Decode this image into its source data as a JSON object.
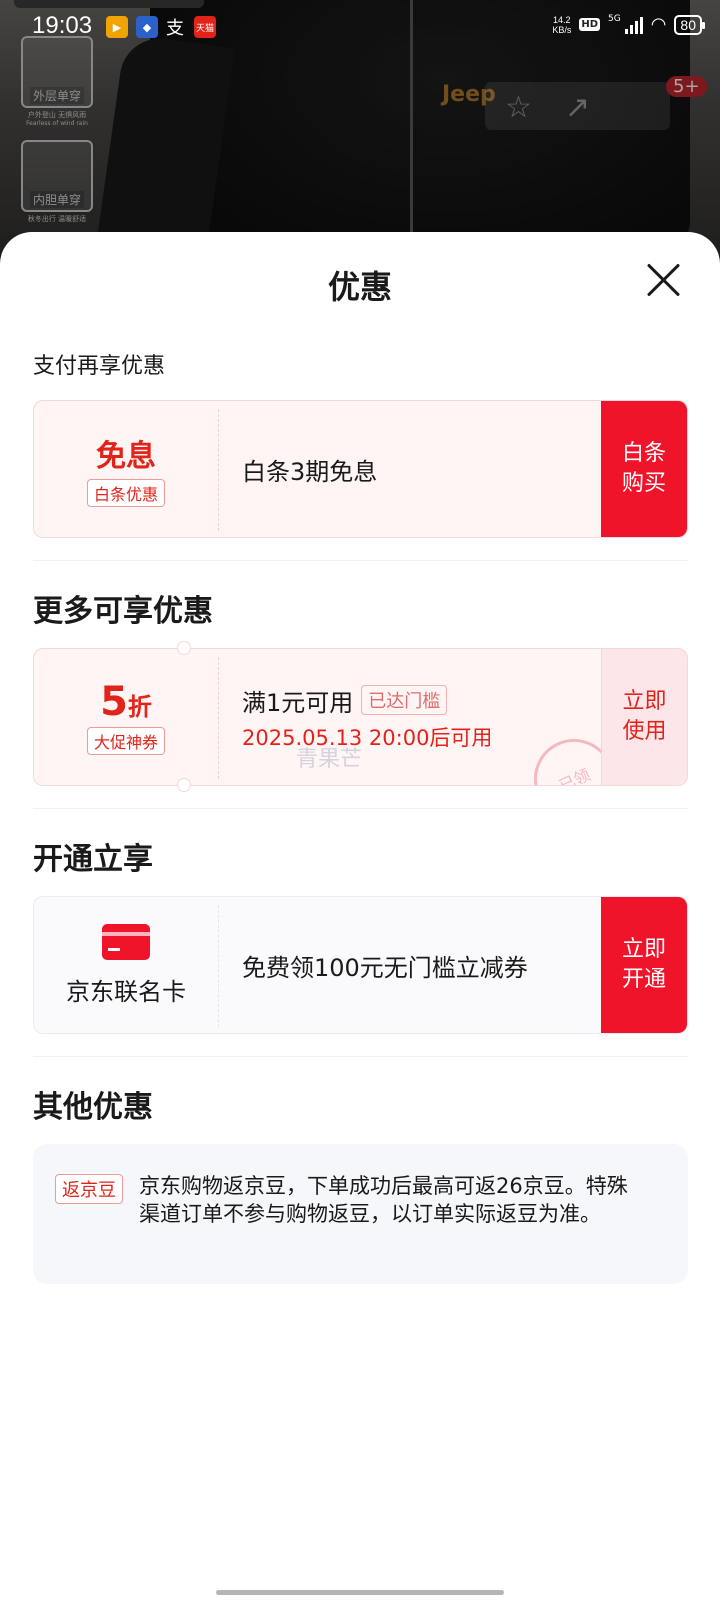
{
  "status_bar": {
    "time": "19:03",
    "net_speed_value": "14.2",
    "net_speed_unit": "KB/s",
    "hd": "HD",
    "network": "5G",
    "battery": "80",
    "notifications": [
      {
        "icon": "video-app-icon",
        "color": "#f1a400"
      },
      {
        "icon": "bank-app-icon",
        "color": "#2a62c9"
      },
      {
        "icon": "alipay-icon",
        "color": "transparent",
        "text": "支"
      },
      {
        "icon": "tmall-app-icon",
        "color": "#e2231a",
        "text": "天猫"
      }
    ]
  },
  "background": {
    "brand": "Jeep",
    "features": [
      {
        "label": "外层单穿",
        "sub": "户外登山 无惧风雨",
        "sub2": "Fearless of wind rain"
      },
      {
        "label": "内胆单穿",
        "sub": "秋冬出行 温暖舒适",
        "sub2": ""
      }
    ],
    "badge_count": "5+"
  },
  "sheet": {
    "title": "优惠",
    "section_pay": "支付再享优惠",
    "baitiao_card": {
      "left_title": "免息",
      "left_tag": "白条优惠",
      "text": "白条3期免息",
      "action_line1": "白条",
      "action_line2": "购买"
    },
    "section_more": "更多可享优惠",
    "coupon_card": {
      "discount_number": "5",
      "discount_unit": "折",
      "left_tag": "大促神券",
      "condition": "满1元可用",
      "status_tag": "已达门槛",
      "valid_time": "2025.05.13 20:00后可用",
      "watermark": "青果芒",
      "stamp": "已领",
      "action_line1": "立即",
      "action_line2": "使用"
    },
    "section_open": "开通立享",
    "card_offer": {
      "left_title": "京东联名卡",
      "text": "免费领100元无门槛立减券",
      "action_line1": "立即",
      "action_line2": "开通"
    },
    "section_other": "其他优惠",
    "other": {
      "tag": "返京豆",
      "text": "京东购物返京豆，下单成功后最高可返26京豆。特殊渠道订单不参与购物返豆，以订单实际返豆为准。"
    }
  },
  "colors": {
    "accent_red": "#e2231a",
    "button_red": "#f0142b",
    "pink_bg": "#fff5f5"
  }
}
